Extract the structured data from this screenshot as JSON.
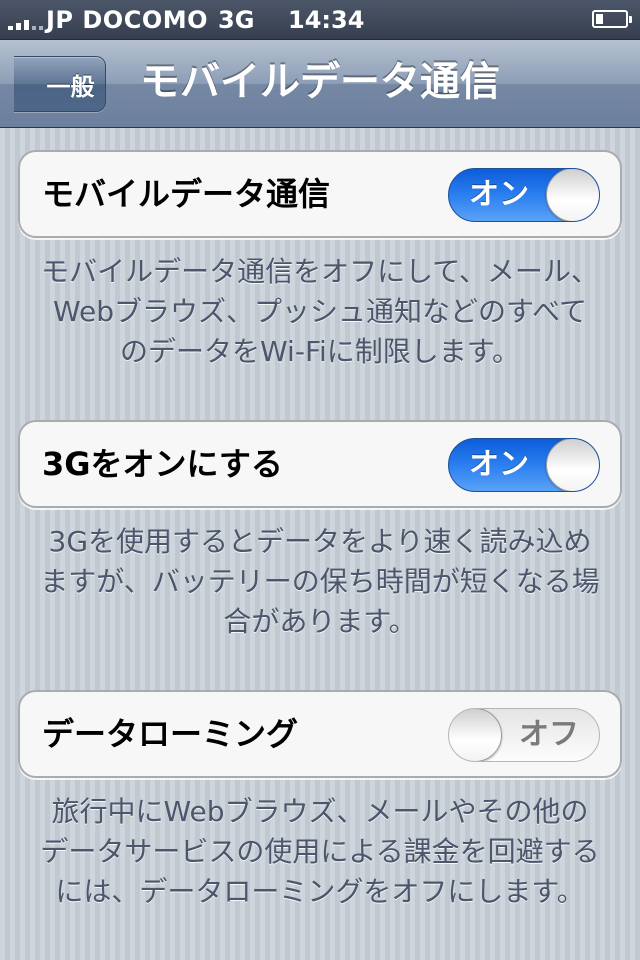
{
  "status_bar": {
    "carrier": "JP DOCOMO",
    "network": "3G",
    "time": "14:34",
    "signal_icon": "signal-bars-icon",
    "battery_icon": "battery-icon",
    "battery_level": 0.25
  },
  "nav": {
    "back_label": "一般",
    "title": "モバイルデータ通信"
  },
  "settings": [
    {
      "label": "モバイルデータ通信",
      "state": "on",
      "switch_text": "オン",
      "footer": "モバイルデータ通信をオフにして、メール、Webブラウズ、プッシュ通知などのすべてのデータをWi-Fiに制限します。"
    },
    {
      "label": "3Gをオンにする",
      "state": "on",
      "switch_text": "オン",
      "footer": "3Gを使用するとデータをより速く読み込めますが、バッテリーの保ち時間が短くなる場合があります。"
    },
    {
      "label": "データローミング",
      "state": "off",
      "switch_text": "オフ",
      "footer": "旅行中にWebブラウズ、メールやその他のデータサービスの使用による課金を回避するには、データローミングをオフにします。"
    }
  ],
  "colors": {
    "switch_on": "#2b7ff0",
    "background": "#c5ccd4",
    "navbar": "#8d9eb6"
  }
}
